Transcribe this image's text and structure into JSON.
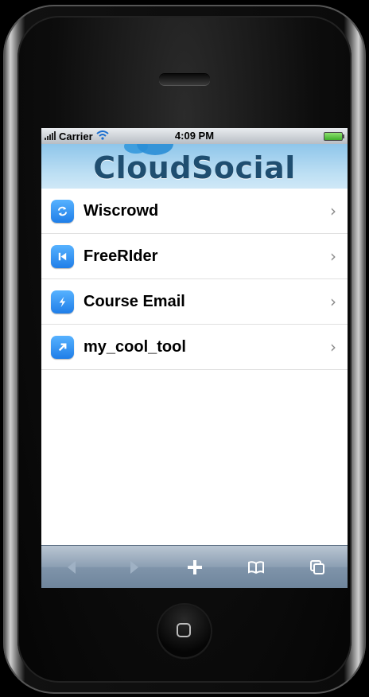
{
  "status": {
    "carrier": "Carrier",
    "time": "4:09 PM"
  },
  "header": {
    "brand": "CloudSocial"
  },
  "apps": [
    {
      "label": "Wiscrowd",
      "icon": "sync-icon"
    },
    {
      "label": "FreeRIder",
      "icon": "skip-back-icon"
    },
    {
      "label": "Course Email",
      "icon": "lightning-icon"
    },
    {
      "label": "my_cool_tool",
      "icon": "arrow-up-right-icon"
    }
  ],
  "toolbar": {
    "back": "back-arrow-icon",
    "forward": "forward-arrow-icon",
    "add": "plus-icon",
    "bookmarks": "book-icon",
    "pages": "pages-icon"
  },
  "colors": {
    "icon_blue": "#1f7ee8",
    "header_sky": "#bfe0f4",
    "brand_text": "#1f4e70",
    "toolbar": "#7f94aa"
  }
}
